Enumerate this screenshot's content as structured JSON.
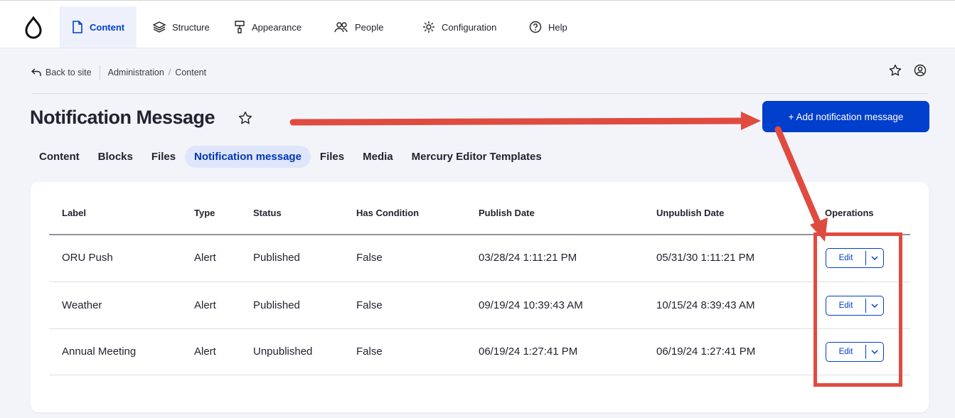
{
  "toolbar": {
    "items": [
      {
        "label": "Content",
        "icon": "document-icon",
        "active": true
      },
      {
        "label": "Structure",
        "icon": "layers-icon"
      },
      {
        "label": "Appearance",
        "icon": "paint-roller-icon"
      },
      {
        "label": "People",
        "icon": "people-icon"
      },
      {
        "label": "Configuration",
        "icon": "gear-icon"
      },
      {
        "label": "Help",
        "icon": "help-circle-icon"
      }
    ]
  },
  "breadcrumb": {
    "back_label": "Back to site",
    "items": [
      "Administration",
      "Content"
    ],
    "separator": "/"
  },
  "page": {
    "title": "Notification Message",
    "add_button_label": "+ Add notification message"
  },
  "tabs": [
    "Content",
    "Blocks",
    "Files",
    "Notification message",
    "Files",
    "Media",
    "Mercury Editor Templates"
  ],
  "active_tab_index": 3,
  "table": {
    "headers": [
      "Label",
      "Type",
      "Status",
      "Has Condition",
      "Publish Date",
      "Unpublish Date",
      "Operations"
    ],
    "rows": [
      {
        "label": "ORU Push",
        "type": "Alert",
        "status": "Published",
        "has_condition": "False",
        "publish_date": "03/28/24 1:11:21 PM",
        "unpublish_date": "05/31/30 1:11:21 PM",
        "op_label": "Edit"
      },
      {
        "label": "Weather",
        "type": "Alert",
        "status": "Published",
        "has_condition": "False",
        "publish_date": "09/19/24 10:39:43 AM",
        "unpublish_date": "10/15/24 8:39:43 AM",
        "op_label": "Edit"
      },
      {
        "label": "Annual Meeting",
        "type": "Alert",
        "status": "Unpublished",
        "has_condition": "False",
        "publish_date": "06/19/24 1:27:41 PM",
        "unpublish_date": "06/19/24 1:27:41 PM",
        "op_label": "Edit"
      }
    ]
  },
  "colors": {
    "accent": "#003ecc",
    "annotation": "#e04b3f",
    "page_bg": "#f3f4f9"
  }
}
